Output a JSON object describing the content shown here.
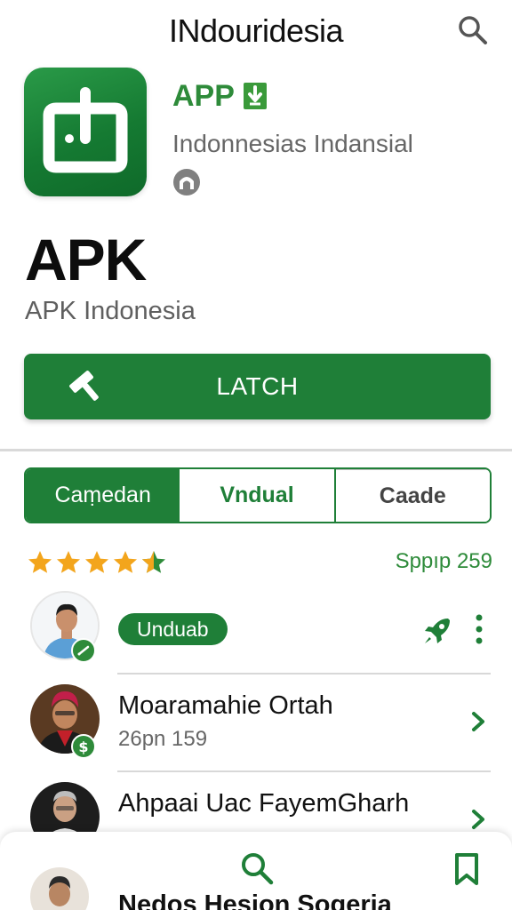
{
  "header": {
    "title": "INdouridesia",
    "search_icon": "search-icon"
  },
  "app": {
    "name": "APP",
    "developer": "Indonnesias Indansial",
    "download_badge_icon": "download-badge-icon",
    "developer_icon": "arch-icon",
    "accent_color": "#1f7f38"
  },
  "hero": {
    "title": "APK",
    "subtitle": "APK Indonesia"
  },
  "primary_button": {
    "label": "LATCH",
    "icon": "hammer-icon"
  },
  "tabs": [
    {
      "label": "Caṃedan",
      "selected": true
    },
    {
      "label": "Vndual",
      "selected": false
    },
    {
      "label": "Caade",
      "selected": false
    }
  ],
  "rating": {
    "stars": 4.5,
    "count_text": "Sppıp 259"
  },
  "list": [
    {
      "type": "action",
      "pill_label": "Unduab",
      "badge": "check"
    },
    {
      "name": "Moaramahie Ortah",
      "subtitle": "26pn 159",
      "badge": "dollar"
    },
    {
      "name": "Ahpaai Uac FayemGharh",
      "subtitle": "",
      "badge": ""
    }
  ],
  "bottom_sheet": {
    "name": "Nedos Hesion Sogeria",
    "nav_icons": [
      "search-icon",
      "bookmark-icon"
    ]
  }
}
